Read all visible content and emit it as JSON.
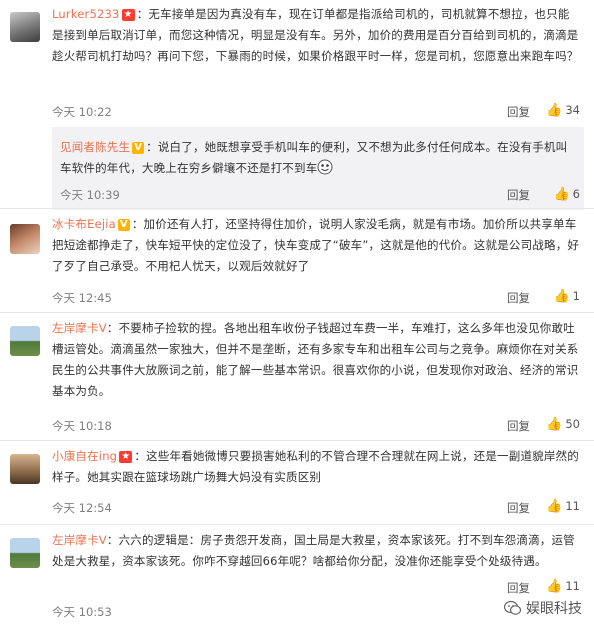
{
  "comments": [
    {
      "user": "Lurker5233",
      "badge": "★",
      "text": "：无车接单是因为真没有车，现在订单都是指派给司机的，司机就算不想拉，也只能是接到单后取消订单，而您这种情况，明显是没有车。另外，加价的费用是百分百给到司机的，滴滴是趁火帮司机打劫吗？再问下您，下暴雨的时候，如果价格跟平时一样，您是司机，您愿意出来跑车吗？",
      "time": "今天 10:22",
      "reply": "回复",
      "likes": "34"
    },
    {
      "user": "冰卡布Eejia",
      "badge": "V",
      "text": "：加价还有人打，还坚持得住加价，说明人家没毛病，就是有市场。加价所以共享单车把短途都挣走了，快车短平快的定位没了，快车变成了“破车”，这就是他的代价。这就是公司战略，好了歹了自己承受。不用杞人忧天，以观后效就好了",
      "time": "今天 12:45",
      "reply": "回复",
      "likes": "1"
    },
    {
      "user": "左岸摩卡V",
      "badge": "",
      "text": "：不要柿子捡软的捏。各地出租车收份子钱超过车费一半，车难打，这么多年也没见你敢吐槽运管处。滴滴虽然一家独大，但并不是垄断，还有多家专车和出租车公司与之竞争。麻烦你在对关系民生的公共事件大放厥词之前，能了解一些基本常识。很喜欢你的小说，但发现你对政治、经济的常识基本为负。",
      "time": "今天 10:18",
      "reply": "回复",
      "likes": "50"
    },
    {
      "user": "小康自在ing",
      "badge": "★",
      "text": "：这些年看她微博只要损害她私利的不管合理不合理就在网上说，还是一副道貌岸然的样子。她其实跟在篮球场跳广场舞大妈没有实质区别",
      "time": "今天 12:54",
      "reply": "回复",
      "likes": "11"
    },
    {
      "user": "左岸摩卡V",
      "badge": "",
      "text": "：六六的逻辑是：房子贵怨开发商，国土局是大救星，资本家该死。打不到车怨滴滴，运管处是大救星，资本家该死。你咋不穿越回66年呢？啥都给你分配，没准你还能享受个处级待遇。",
      "time": "今天 10:53",
      "reply": "回复",
      "likes": "11"
    }
  ],
  "nested_reply": {
    "user": "见闻者陈先生",
    "badge": "V",
    "text": "：说白了，她既想享受手机叫车的便利，又不想为此多付任何成本。在没有手机叫车软件的年代，大晚上在穷乡僻壤不还是打不到车",
    "time": "今天 10:39",
    "reply": "回复",
    "likes": "6"
  },
  "watermark": "娱眼科技",
  "colors": {
    "username": "#eb7350",
    "badge_v": "#ffb400",
    "badge_star": "#ff3b30"
  }
}
